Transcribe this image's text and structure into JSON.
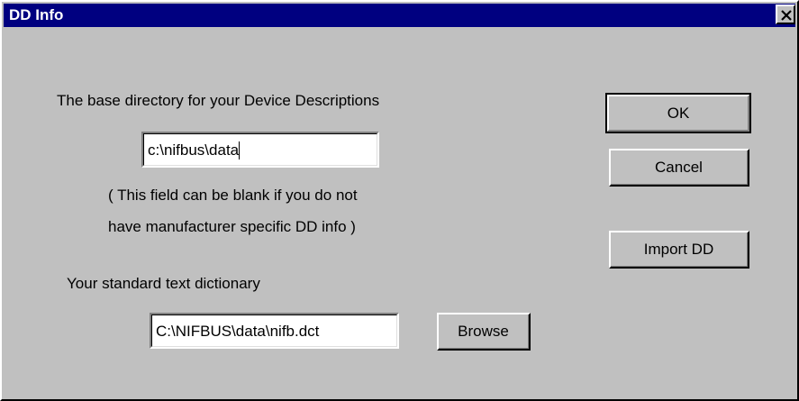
{
  "window": {
    "title": "DD Info"
  },
  "base_dir": {
    "label": "The base directory for your Device Descriptions",
    "value": "c:\\nifbus\\data",
    "note_line1": "( This field can be blank if you do not",
    "note_line2": "have manufacturer specific DD info )"
  },
  "dictionary": {
    "label": "Your standard text dictionary",
    "value": "C:\\NIFBUS\\data\\nifb.dct",
    "browse_label": "Browse"
  },
  "buttons": {
    "ok": "OK",
    "cancel": "Cancel",
    "import": "Import DD"
  }
}
